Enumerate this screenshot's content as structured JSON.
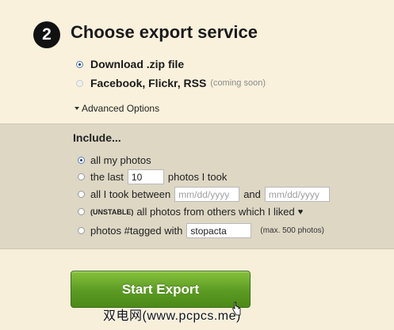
{
  "step": {
    "number": "2",
    "title": "Choose export service"
  },
  "services": [
    {
      "label": "Download .zip file",
      "note": "",
      "selected": true,
      "disabled": false
    },
    {
      "label": "Facebook, Flickr, RSS",
      "note": "(coming soon)",
      "selected": false,
      "disabled": true
    }
  ],
  "advanced_options_label": "Advanced Options",
  "include": {
    "label": "Include...",
    "all_photos": "all my photos",
    "last_prefix": "the last",
    "last_value": "10",
    "last_suffix": "photos I took",
    "between_prefix": "all I took between",
    "date_placeholder_1": "mm/dd/yyyy",
    "between_and": "and",
    "date_placeholder_2": "mm/dd/yyyy",
    "unstable_tag": "(UNSTABLE)",
    "liked_text": "all photos from others which I liked",
    "heart": "♥",
    "tagged_prefix": "photos #tagged with",
    "tag_value": "stopacta",
    "tag_note": "(max. 500 photos)"
  },
  "start_button_label": "Start Export",
  "watermark": "双电网(www.pcpcs.me)",
  "colors": {
    "button_green": "#5b9a23",
    "panel_bg": "#ddd7c4",
    "page_bg": "#f9f1dc"
  }
}
